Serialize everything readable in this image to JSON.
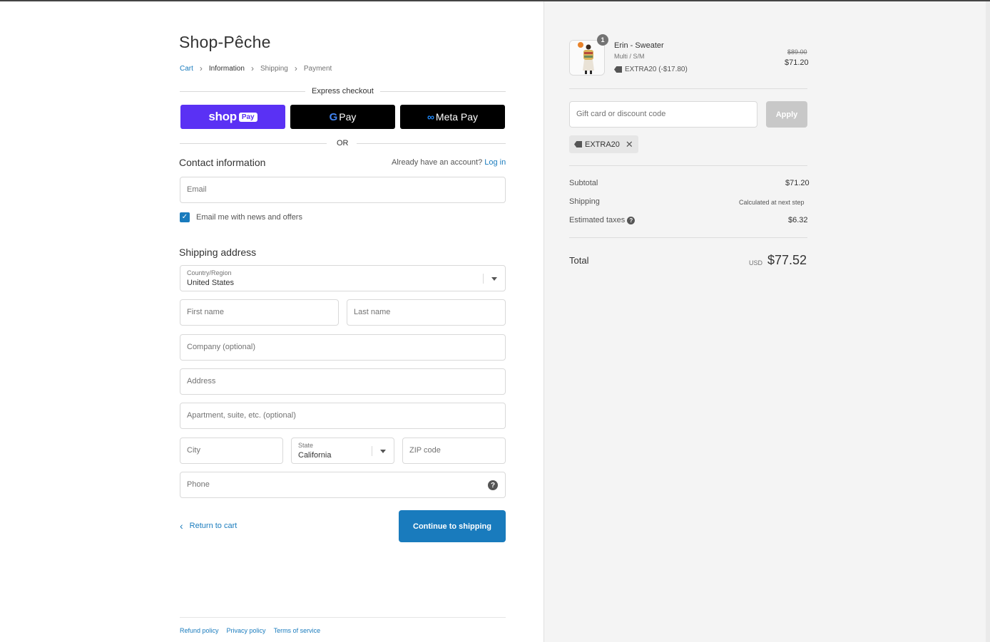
{
  "shop": {
    "name": "Shop-Pêche"
  },
  "breadcrumb": [
    {
      "label": "Cart"
    },
    {
      "label": "Information"
    },
    {
      "label": "Shipping"
    },
    {
      "label": "Payment"
    }
  ],
  "express": {
    "label": "Express checkout",
    "shoppay_word": "shop",
    "shoppay_pill": "Pay",
    "gpay_g": "G",
    "gpay_label": "Pay",
    "metapay_mark": "∞",
    "metapay_label": "Meta Pay",
    "or": "OR"
  },
  "contact": {
    "title": "Contact information",
    "account_prompt": "Already have an account?",
    "login": "Log in",
    "email_placeholder": "Email",
    "newsletter_label": "Email me with news and offers",
    "newsletter_checked": true
  },
  "shipping": {
    "title": "Shipping address",
    "country_label": "Country/Region",
    "country_value": "United States",
    "first_name": "First name",
    "last_name": "Last name",
    "company": "Company (optional)",
    "address": "Address",
    "apartment": "Apartment, suite, etc. (optional)",
    "city": "City",
    "state_label": "State",
    "state_value": "California",
    "zip": "ZIP code",
    "phone": "Phone",
    "help_glyph": "?"
  },
  "actions": {
    "return_label": "Return to cart",
    "continue_label": "Continue to shipping"
  },
  "footer": {
    "links": [
      "Refund policy",
      "Privacy policy",
      "Terms of service"
    ]
  },
  "order": {
    "item": {
      "name": "Erin - Sweater",
      "variant": "Multi / S/M",
      "discount": "EXTRA20 (-$17.80)",
      "original_price": "$89.00",
      "price": "$71.20",
      "quantity": "1"
    },
    "discount_placeholder": "Gift card or discount code",
    "apply_label": "Apply",
    "applied_code": "EXTRA20",
    "remove_glyph": "✕",
    "subtotal_label": "Subtotal",
    "subtotal_value": "$71.20",
    "shipping_label": "Shipping",
    "shipping_value": "Calculated at next step",
    "taxes_label": "Estimated taxes",
    "taxes_value": "$6.32",
    "total_label": "Total",
    "currency": "USD",
    "total_value": "$77.52"
  },
  "colors": {
    "accent": "#197bbd",
    "shoppay": "#5a31f4",
    "sidebar_bg": "#f4f4f4"
  }
}
